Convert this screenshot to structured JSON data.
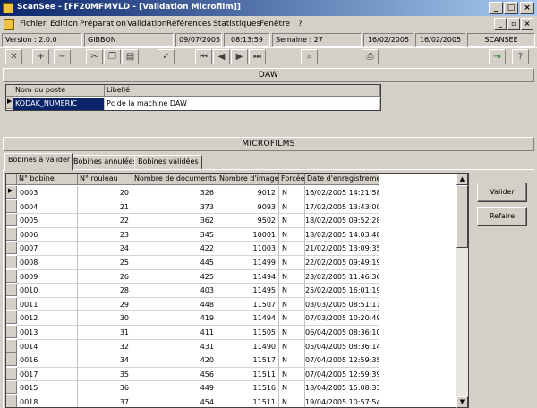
{
  "window": {
    "title": "ScanSee - [FF20MFMVLD - [Validation Microfilm]]",
    "caption_buttons": [
      "_",
      "□",
      "×"
    ],
    "mdi_buttons": [
      "_",
      "▫",
      "×"
    ]
  },
  "menu": [
    "Fichier",
    "Edition",
    "Préparation",
    "Validation",
    "Références",
    "Statistiques",
    "Fenêtre",
    "?"
  ],
  "status": {
    "version": "Version : 2.0.0",
    "user": "GIBBON",
    "date": "09/07/2005",
    "time": "08:13:59",
    "week": "Semaine : 27",
    "date_from": "16/02/2005",
    "date_to": "16/02/2005",
    "app": "SCANSEE"
  },
  "toolbar": {
    "icons": [
      "close-icon",
      "add-icon",
      "remove-icon",
      "cut-icon",
      "copy-icon",
      "paste-icon",
      "check-icon",
      "first-icon",
      "prev-icon",
      "next-icon",
      "last-icon",
      "search-icon",
      "print-icon",
      "exit-icon",
      "help-icon"
    ]
  },
  "daw": {
    "header": "DAW",
    "columns": [
      "Nom du poste",
      "Libellé"
    ],
    "rows": [
      [
        "KODAK_NUMERIC",
        "Pc de la machine DAW"
      ]
    ]
  },
  "microfilms": {
    "header": "MICROFILMS",
    "tabs": [
      "Bobines à valider",
      "Bobines annulées",
      "Bobines validées"
    ],
    "active_tab": 0,
    "columns": [
      "N° bobine",
      "N° rouleau",
      "Nombre de documents",
      "Nombre d'images",
      "Forcée",
      "Date d'enregistrement"
    ],
    "rows": [
      [
        "0003",
        "20",
        "326",
        "9012",
        "N",
        "16/02/2005 14:21:58"
      ],
      [
        "0004",
        "21",
        "373",
        "9093",
        "N",
        "17/02/2005 13:43:00"
      ],
      [
        "0005",
        "22",
        "362",
        "9502",
        "N",
        "18/02/2005 09:52:28"
      ],
      [
        "0006",
        "23",
        "345",
        "10001",
        "N",
        "18/02/2005 14:03:48"
      ],
      [
        "0007",
        "24",
        "422",
        "11003",
        "N",
        "21/02/2005 13:09:35"
      ],
      [
        "0008",
        "25",
        "445",
        "11499",
        "N",
        "22/02/2005 09:49:19"
      ],
      [
        "0009",
        "26",
        "425",
        "11494",
        "N",
        "23/02/2005 11:46:36"
      ],
      [
        "0010",
        "28",
        "403",
        "11495",
        "N",
        "25/02/2005 16:01:19"
      ],
      [
        "0011",
        "29",
        "448",
        "11507",
        "N",
        "03/03/2005 08:51:11"
      ],
      [
        "0012",
        "30",
        "419",
        "11494",
        "N",
        "07/03/2005 10:20:49"
      ],
      [
        "0013",
        "31",
        "411",
        "11505",
        "N",
        "06/04/2005 08:36:10"
      ],
      [
        "0014",
        "32",
        "431",
        "11490",
        "N",
        "05/04/2005 08:36:14"
      ],
      [
        "0016",
        "34",
        "420",
        "11517",
        "N",
        "07/04/2005 12:59:35"
      ],
      [
        "0017",
        "35",
        "456",
        "11511",
        "N",
        "07/04/2005 12:59:39"
      ],
      [
        "0015",
        "36",
        "449",
        "11516",
        "N",
        "18/04/2005 15:08:33"
      ],
      [
        "0018",
        "37",
        "454",
        "11511",
        "N",
        "19/04/2005 10:57:54"
      ]
    ]
  },
  "actions": {
    "validate": "Valider",
    "refresh": "Refaire"
  }
}
